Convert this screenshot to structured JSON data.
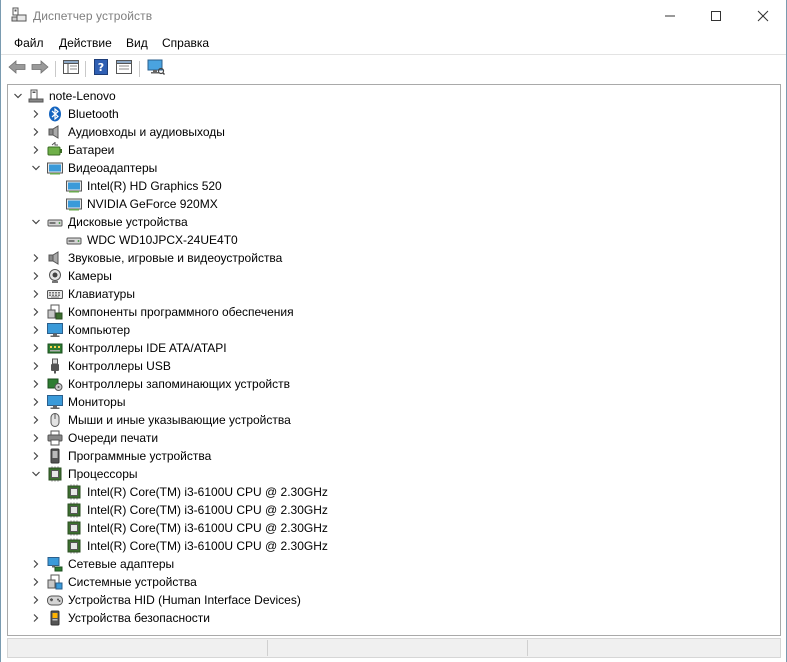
{
  "window": {
    "title": "Диспетчер устройств"
  },
  "menu": {
    "file": "Файл",
    "action": "Действие",
    "view": "Вид",
    "help": "Справка"
  },
  "toolbar": {
    "buttons": [
      "back-arrow-icon",
      "forward-arrow-icon",
      "properties-icon",
      "help-icon",
      "update-driver-icon",
      "scan-hardware-icon"
    ]
  },
  "tree": {
    "root": "note-Lenovo",
    "rows": [
      {
        "label": "Bluetooth",
        "icon": "bluetooth-icon",
        "level": 1,
        "state": "collapsed"
      },
      {
        "label": "Аудиовходы и аудиовыходы",
        "icon": "speaker-icon",
        "level": 1,
        "state": "collapsed"
      },
      {
        "label": "Батареи",
        "icon": "battery-icon",
        "level": 1,
        "state": "collapsed"
      },
      {
        "label": "Видеоадаптеры",
        "icon": "display-adapter-icon",
        "level": 1,
        "state": "expanded"
      },
      {
        "label": "Intel(R) HD Graphics 520",
        "icon": "display-adapter-icon",
        "level": 2,
        "state": "leaf"
      },
      {
        "label": "NVIDIA GeForce 920MX",
        "icon": "display-adapter-icon",
        "level": 2,
        "state": "leaf"
      },
      {
        "label": "Дисковые устройства",
        "icon": "disk-drive-icon",
        "level": 1,
        "state": "expanded"
      },
      {
        "label": "WDC WD10JPCX-24UE4T0",
        "icon": "disk-drive-icon",
        "level": 2,
        "state": "leaf"
      },
      {
        "label": "Звуковые, игровые и видеоустройства",
        "icon": "speaker-icon",
        "level": 1,
        "state": "collapsed"
      },
      {
        "label": "Камеры",
        "icon": "camera-icon",
        "level": 1,
        "state": "collapsed"
      },
      {
        "label": "Клавиатуры",
        "icon": "keyboard-icon",
        "level": 1,
        "state": "collapsed"
      },
      {
        "label": "Компоненты программного обеспечения",
        "icon": "software-component-icon",
        "level": 1,
        "state": "collapsed"
      },
      {
        "label": "Компьютер",
        "icon": "computer-icon",
        "level": 1,
        "state": "collapsed"
      },
      {
        "label": "Контроллеры IDE ATA/ATAPI",
        "icon": "ide-controller-icon",
        "level": 1,
        "state": "collapsed"
      },
      {
        "label": "Контроллеры USB",
        "icon": "usb-icon",
        "level": 1,
        "state": "collapsed"
      },
      {
        "label": "Контроллеры запоминающих устройств",
        "icon": "storage-controller-icon",
        "level": 1,
        "state": "collapsed"
      },
      {
        "label": "Мониторы",
        "icon": "monitor-icon",
        "level": 1,
        "state": "collapsed"
      },
      {
        "label": "Мыши и иные указывающие устройства",
        "icon": "mouse-icon",
        "level": 1,
        "state": "collapsed"
      },
      {
        "label": "Очереди печати",
        "icon": "printer-icon",
        "level": 1,
        "state": "collapsed"
      },
      {
        "label": "Программные устройства",
        "icon": "software-device-icon",
        "level": 1,
        "state": "collapsed"
      },
      {
        "label": "Процессоры",
        "icon": "processor-icon",
        "level": 1,
        "state": "expanded"
      },
      {
        "label": "Intel(R) Core(TM) i3-6100U CPU @ 2.30GHz",
        "icon": "processor-icon",
        "level": 2,
        "state": "leaf"
      },
      {
        "label": "Intel(R) Core(TM) i3-6100U CPU @ 2.30GHz",
        "icon": "processor-icon",
        "level": 2,
        "state": "leaf"
      },
      {
        "label": "Intel(R) Core(TM) i3-6100U CPU @ 2.30GHz",
        "icon": "processor-icon",
        "level": 2,
        "state": "leaf"
      },
      {
        "label": "Intel(R) Core(TM) i3-6100U CPU @ 2.30GHz",
        "icon": "processor-icon",
        "level": 2,
        "state": "leaf"
      },
      {
        "label": "Сетевые адаптеры",
        "icon": "network-adapter-icon",
        "level": 1,
        "state": "collapsed"
      },
      {
        "label": "Системные устройства",
        "icon": "system-devices-icon",
        "level": 1,
        "state": "collapsed"
      },
      {
        "label": "Устройства HID (Human Interface Devices)",
        "icon": "hid-icon",
        "level": 1,
        "state": "collapsed"
      },
      {
        "label": "Устройства безопасности",
        "icon": "security-device-icon",
        "level": 1,
        "state": "collapsed"
      }
    ]
  },
  "colors": {
    "selection": "#cce8ff",
    "monitor_blue": "#2f8fd8",
    "cpu_green": "#3c6e2f",
    "bluetooth_blue": "#1565c0"
  }
}
